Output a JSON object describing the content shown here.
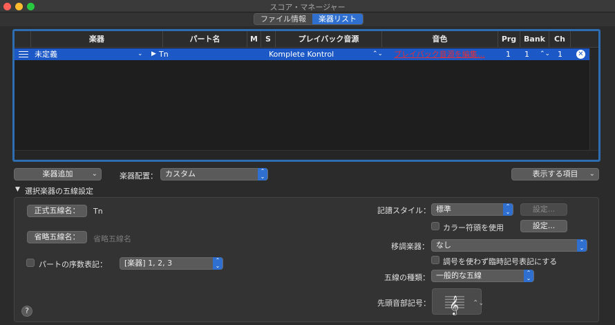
{
  "window": {
    "title": "スコア・マネージャー"
  },
  "tabs": [
    {
      "label": "ファイル情報"
    },
    {
      "label": "楽器リスト"
    }
  ],
  "table": {
    "columns": [
      "楽器",
      "パート名",
      "M",
      "S",
      "プレイバック音源",
      "音色",
      "Prg",
      "Bank",
      "Ch"
    ],
    "rows": [
      {
        "instrument": "未定義",
        "part": "Tn",
        "playback": "Komplete Kontrol",
        "sound": "プレイバック音源を編集…",
        "prg": "1",
        "bank": "1",
        "ch": "1"
      }
    ]
  },
  "toolbar": {
    "add_instrument": "楽器追加",
    "arrangement_label": "楽器配置：",
    "arrangement_value": "カスタム",
    "show_items": "表示する項目"
  },
  "staff_settings": {
    "title": "選択楽器の五線設定",
    "full_name_button": "正式五線名：",
    "full_name_value": "Tn",
    "short_name_button": "省略五線名：",
    "short_name_placeholder": "省略五線名",
    "ordinal_label": "パートの序数表記：",
    "ordinal_value": "[楽器] 1, 2, 3",
    "notation_style_label": "記譜スタイル：",
    "notation_style_value": "標準",
    "settings_button_1": "設定...",
    "settings_button_2": "設定...",
    "color_notehead_label": "カラー符頭を使用",
    "transposing_label": "移調楽器：",
    "transposing_value": "なし",
    "key_accidental_label": "調号を使わず臨時記号表記にする",
    "staff_type_label": "五線の種類：",
    "staff_type_value": "一般的な五線",
    "clef_label": "先頭音部記号："
  },
  "help": {
    "label": "?"
  },
  "accent_color": "#2e6fd0",
  "selection_color": "#1c59c7",
  "link_color": "#e0303a"
}
